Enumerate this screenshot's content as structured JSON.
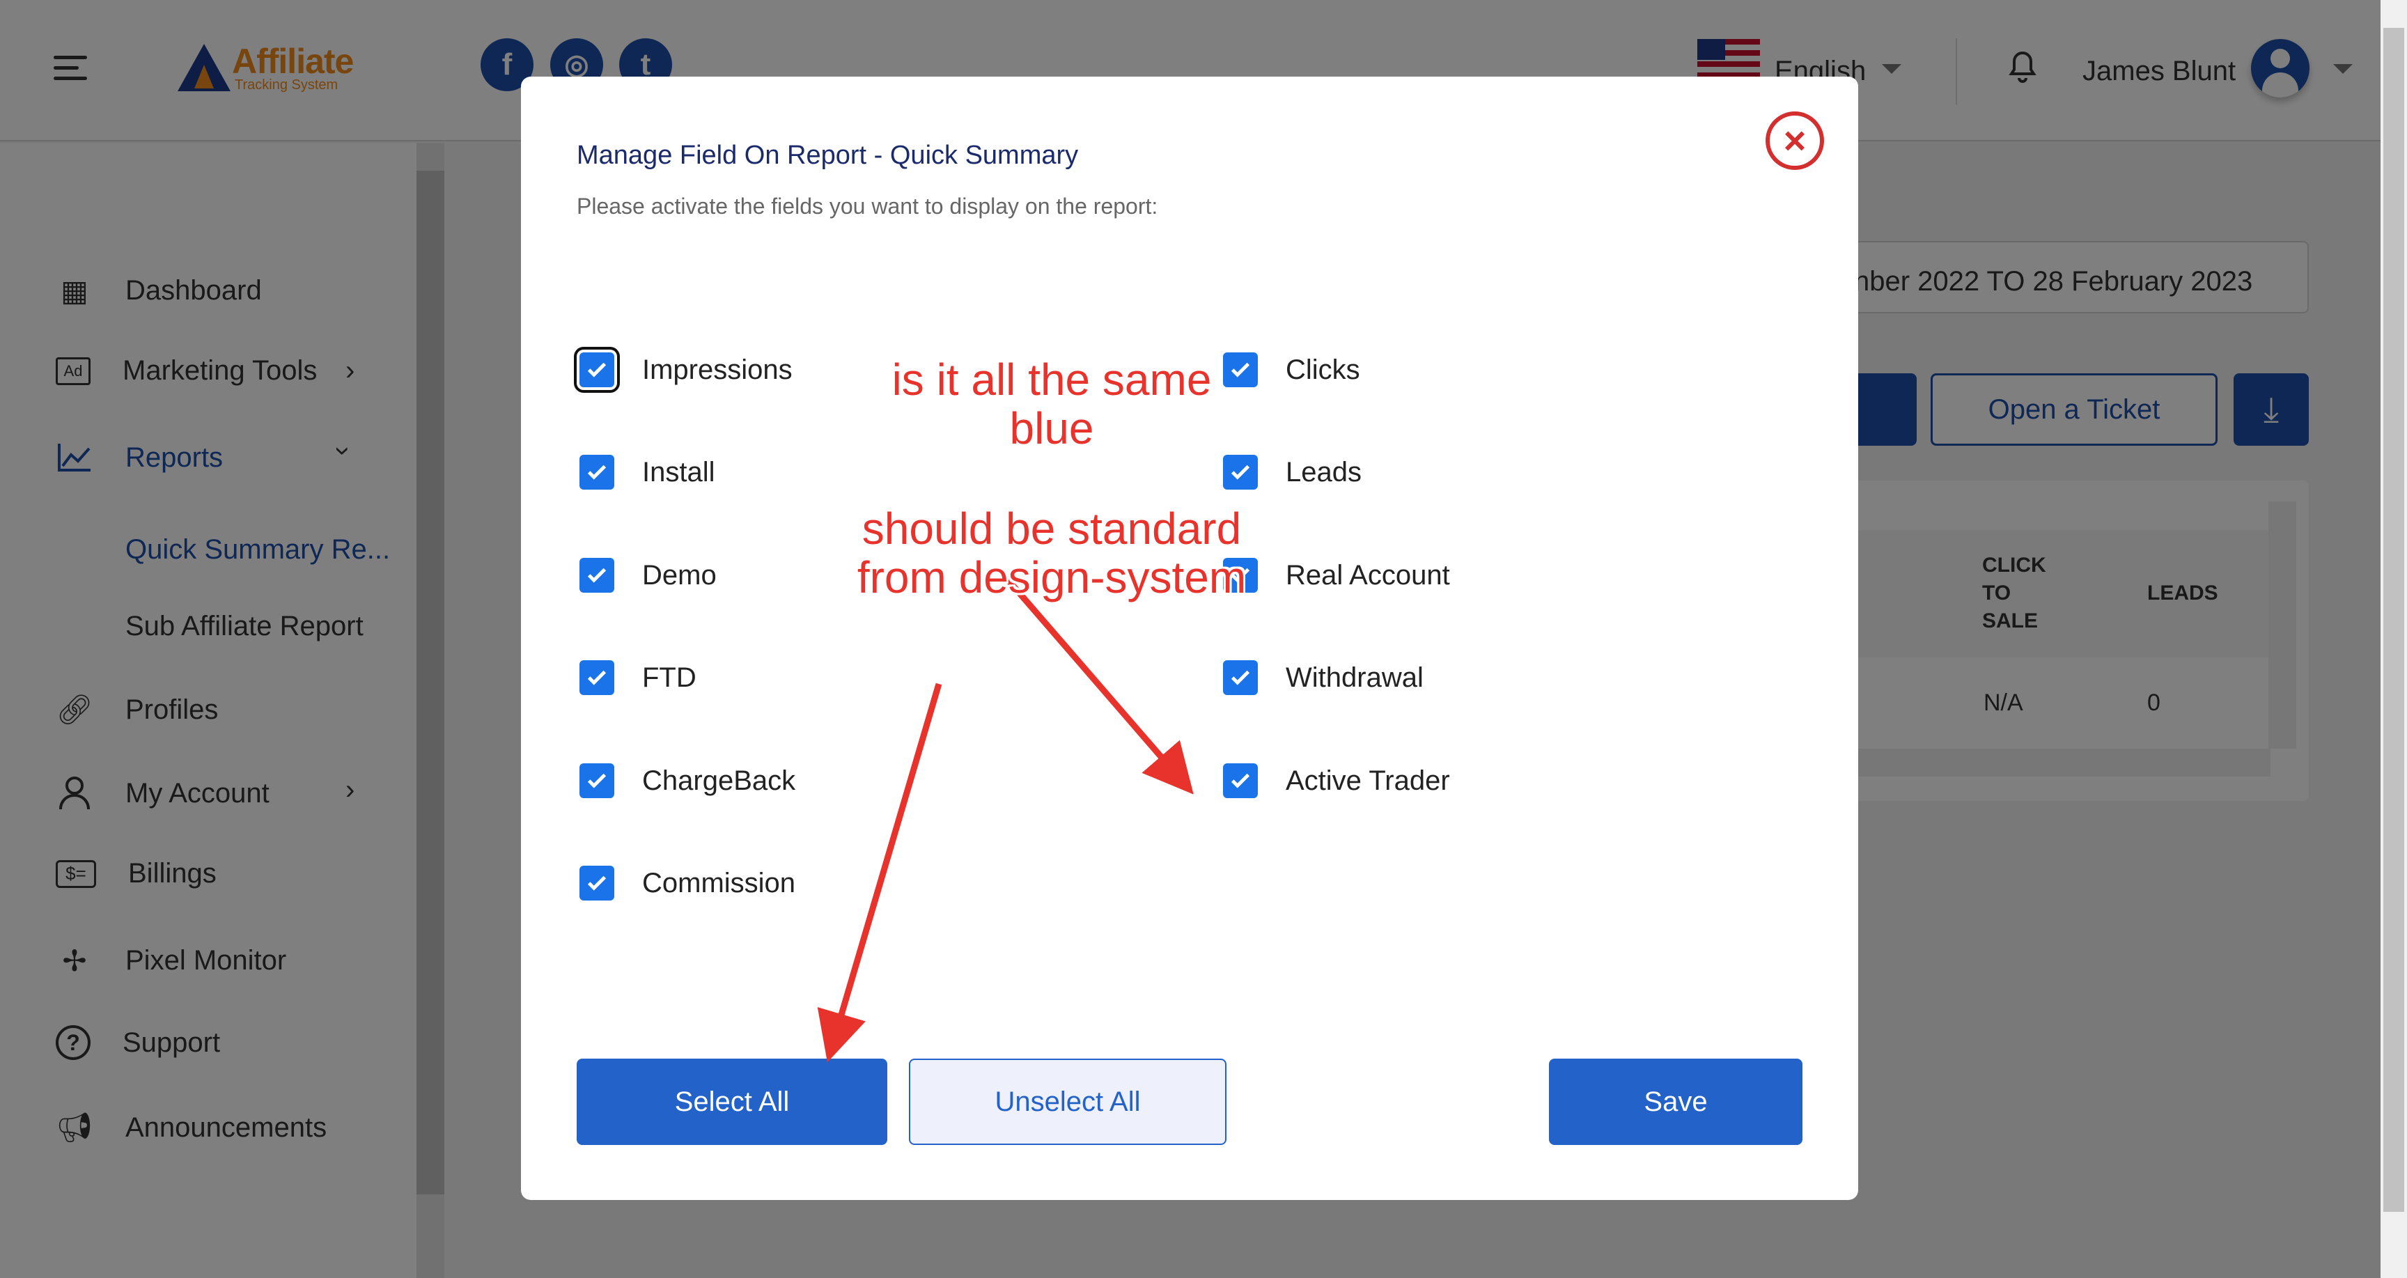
{
  "header": {
    "logo_title": "Affiliate",
    "logo_subtitle": "Tracking System",
    "social": [
      "f",
      "◎",
      "t"
    ],
    "language": "English",
    "user_name": "James Blunt"
  },
  "sidebar": {
    "items": [
      {
        "label": "Dashboard",
        "icon": "dashboard-icon"
      },
      {
        "label": "Marketing Tools",
        "icon": "ad-icon"
      },
      {
        "label": "Reports",
        "icon": "chart-icon"
      },
      {
        "label": "Profiles",
        "icon": "link-icon"
      },
      {
        "label": "My Account",
        "icon": "user-icon"
      },
      {
        "label": "Billings",
        "icon": "billing-icon"
      },
      {
        "label": "Pixel Monitor",
        "icon": "pixel-icon"
      },
      {
        "label": "Support",
        "icon": "help-icon"
      },
      {
        "label": "Announcements",
        "icon": "megaphone-icon"
      }
    ],
    "sub_items": [
      "Quick Summary Re...",
      "Sub Affiliate Report"
    ]
  },
  "main": {
    "date_range": "nber 2022    TO    28 February 2023",
    "open_ticket": "Open a Ticket",
    "table": {
      "headers": [
        "CLICK\nTO\nSALE",
        "LEADS"
      ],
      "row": [
        "N/A",
        "0"
      ]
    }
  },
  "modal": {
    "title": "Manage Field On Report - Quick Summary",
    "subtitle": "Please activate the fields you want to display on the report:",
    "fields_left": [
      "Impressions",
      "Install",
      "Demo",
      "FTD",
      "ChargeBack",
      "Commission"
    ],
    "fields_right": [
      "Clicks",
      "Leads",
      "Real Account",
      "Withdrawal",
      "Active Trader"
    ],
    "select_all": "Select All",
    "unselect_all": "Unselect All",
    "save": "Save"
  },
  "annotations": {
    "note1": "is it all the same\nblue",
    "note2": "should be standard\nfrom design-system"
  }
}
